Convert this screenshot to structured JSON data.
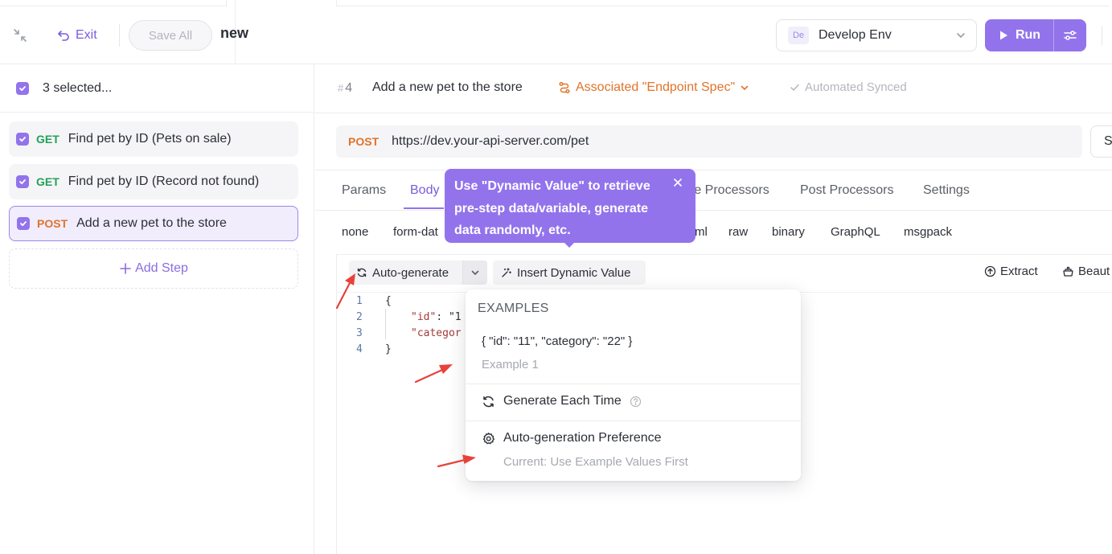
{
  "topbar": {
    "exit_label": "Exit",
    "save_all_label": "Save All",
    "doc_title": "new",
    "env": {
      "badge": "De",
      "name": "Develop Env"
    },
    "run_label": "Run"
  },
  "left": {
    "selected_text": "3 selected...",
    "steps": [
      {
        "method": "GET",
        "name": "Find pet by ID (Pets on sale)"
      },
      {
        "method": "GET",
        "name": "Find pet by ID (Record not found)"
      },
      {
        "method": "POST",
        "name": "Add a new pet to the store"
      }
    ],
    "add_step_label": "Add Step"
  },
  "step": {
    "number": "4",
    "title": "Add a new pet to the store",
    "associated_label": "Associated \"Endpoint Spec\"",
    "synced_label": "Automated Synced"
  },
  "request": {
    "method": "POST",
    "url": "https://dev.your-api-server.com/pet",
    "send_partial": "S"
  },
  "tabs": {
    "params": "Params",
    "body": "Body",
    "pre_processors_partial": "re Processors",
    "post_processors": "Post Processors",
    "settings": "Settings"
  },
  "body_types": {
    "none": "none",
    "form_data_partial": "form-dat",
    "xml_partial": "ml",
    "raw": "raw",
    "binary": "binary",
    "graphql": "GraphQL",
    "msgpack": "msgpack"
  },
  "editor": {
    "auto_generate_label": "Auto-generate",
    "insert_dynamic_label": "Insert Dynamic Value",
    "extract_label": "Extract",
    "beautify_partial": "Beaut",
    "lines": [
      "1",
      "2",
      "3",
      "4"
    ],
    "code": {
      "open": "{",
      "key1": "\"id\"",
      "val1_partial": ": \"1",
      "key2_partial": "\"categor",
      "close": "}"
    }
  },
  "tooltip": {
    "text": "Use \"Dynamic Value\" to retrieve pre-step data/variable, generate data randomly, etc."
  },
  "menu": {
    "heading": "EXAMPLES",
    "example_value": "{ \"id\": \"11\", \"category\": \"22\" }",
    "example_label": "Example 1",
    "generate_each_time": "Generate Each Time",
    "preference_label": "Auto-generation Preference",
    "preference_current": "Current: Use Example Values First"
  },
  "colors": {
    "accent": "#9373ec",
    "get": "#23a05b",
    "post": "#e0742a",
    "annotation_arrow": "#e8423a"
  }
}
